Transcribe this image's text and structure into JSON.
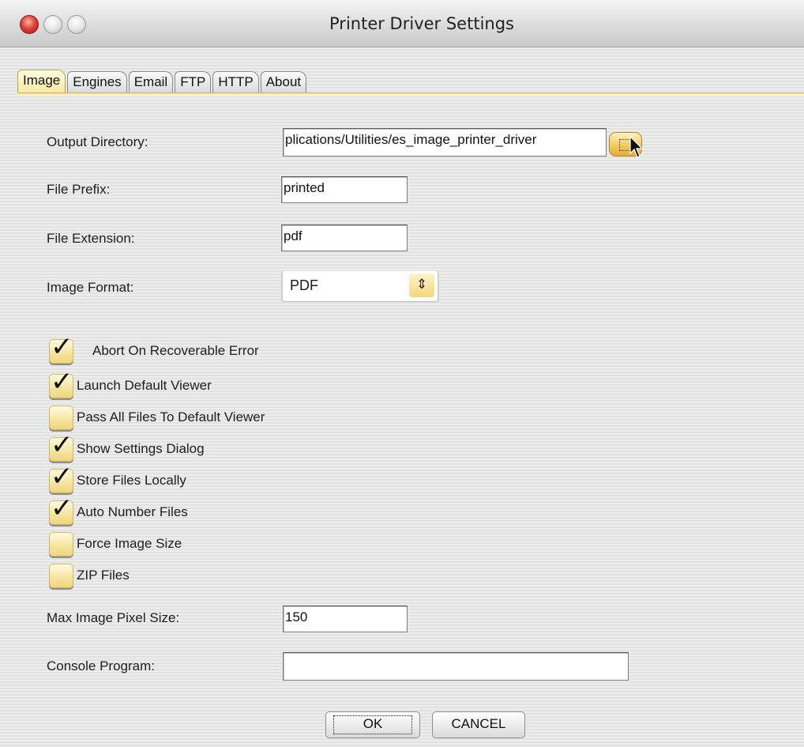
{
  "window": {
    "title": "Printer Driver Settings"
  },
  "tabs": [
    {
      "label": "Image",
      "active": true
    },
    {
      "label": "Engines",
      "active": false
    },
    {
      "label": "Email",
      "active": false
    },
    {
      "label": "FTP",
      "active": false
    },
    {
      "label": "HTTP",
      "active": false
    },
    {
      "label": "About",
      "active": false
    }
  ],
  "form": {
    "output_directory": {
      "label": "Output Directory:",
      "value": "plications/Utilities/es_image_printer_driver"
    },
    "file_prefix": {
      "label": "File Prefix:",
      "value": "printed"
    },
    "file_extension": {
      "label": "File Extension:",
      "value": "pdf"
    },
    "image_format": {
      "label": "Image Format:",
      "value": "PDF"
    },
    "max_image_pixel_size": {
      "label": "Max Image Pixel Size:",
      "value": "150"
    },
    "console_program": {
      "label": "Console Program:",
      "value": ""
    }
  },
  "checkboxes": [
    {
      "label": "Abort On Recoverable Error",
      "checked": true
    },
    {
      "label": "Launch Default Viewer",
      "checked": true
    },
    {
      "label": "Pass All Files To Default Viewer",
      "checked": false
    },
    {
      "label": "Show Settings Dialog",
      "checked": true
    },
    {
      "label": "Store Files Locally",
      "checked": true
    },
    {
      "label": "Auto Number Files",
      "checked": true
    },
    {
      "label": "Force Image Size",
      "checked": false
    },
    {
      "label": "ZIP Files",
      "checked": false
    }
  ],
  "buttons": {
    "ok": "OK",
    "cancel": "CANCEL"
  },
  "icons": {
    "close": "close-icon",
    "minimize": "minimize-icon",
    "zoom": "zoom-icon",
    "browse": "browse-icon",
    "stepper": "stepper-arrows-icon",
    "pointer": "mouse-pointer-icon"
  },
  "colors": {
    "accent": "#f3d67e",
    "close_red": "#e0443a",
    "tab_active": "#f6eaa5"
  }
}
